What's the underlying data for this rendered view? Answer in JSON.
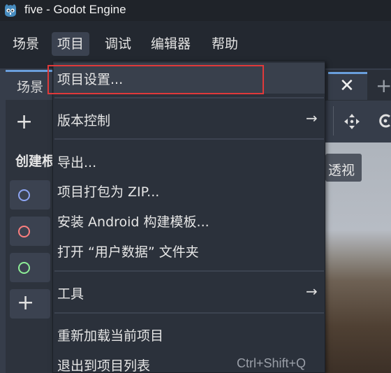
{
  "window": {
    "title": "five - Godot Engine"
  },
  "menubar": {
    "items": [
      {
        "label": "场景"
      },
      {
        "label": "项目"
      },
      {
        "label": "调试"
      },
      {
        "label": "编辑器"
      },
      {
        "label": "帮助"
      }
    ],
    "active_index": 1
  },
  "scene_dock": {
    "tab_label": "场景",
    "add_glyph": "+",
    "create_label": "创建根",
    "nodes": [
      {
        "icon": "circle-outline-icon",
        "color": "#8da5f3"
      },
      {
        "icon": "circle-outline-icon",
        "color": "#fc7f7f"
      },
      {
        "icon": "circle-outline-icon",
        "color": "#8eef97"
      }
    ],
    "other_glyph": "+"
  },
  "viewport": {
    "close_glyph": "✕",
    "add_tab_glyph": "+",
    "perspective_label": "透视"
  },
  "project_menu": {
    "items": [
      {
        "label": "项目设置..."
      },
      {
        "label": "版本控制",
        "submenu": true
      },
      {
        "label": "导出..."
      },
      {
        "label": "项目打包为 ZIP..."
      },
      {
        "label": "安装 Android 构建模板..."
      },
      {
        "label": "打开 “用户数据” 文件夹"
      },
      {
        "label": "工具",
        "submenu": true
      },
      {
        "label": "重新加载当前项目"
      },
      {
        "label": "退出到项目列表",
        "shortcut": "Ctrl+Shift+Q"
      }
    ],
    "submenu_glyph": "→"
  },
  "colors": {
    "accent": "#6a9fdc",
    "highlight_box": "#e0393a"
  }
}
